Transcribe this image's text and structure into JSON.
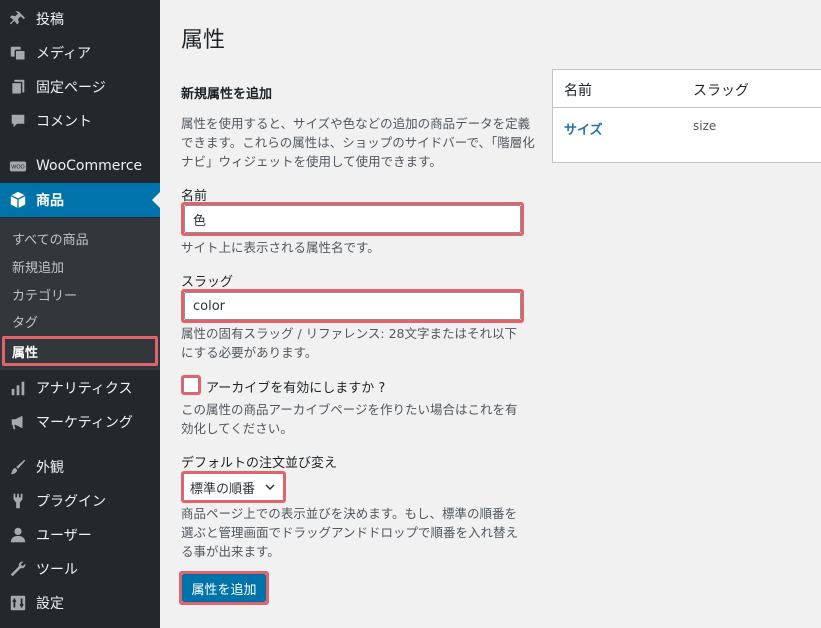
{
  "sidebar": {
    "items": [
      {
        "label": "投稿",
        "icon": "pushpin-icon"
      },
      {
        "label": "メディア",
        "icon": "media-icon"
      },
      {
        "label": "固定ページ",
        "icon": "pages-icon"
      },
      {
        "label": "コメント",
        "icon": "comment-icon"
      },
      {
        "label": "WooCommerce",
        "icon": "woocommerce-icon"
      },
      {
        "label": "商品",
        "icon": "product-box-icon"
      },
      {
        "label": "アナリティクス",
        "icon": "bar-chart-icon"
      },
      {
        "label": "マーケティング",
        "icon": "megaphone-icon"
      },
      {
        "label": "外観",
        "icon": "brush-icon"
      },
      {
        "label": "プラグイン",
        "icon": "plugin-icon"
      },
      {
        "label": "ユーザー",
        "icon": "user-icon"
      },
      {
        "label": "ツール",
        "icon": "wrench-icon"
      },
      {
        "label": "設定",
        "icon": "settings-icon"
      }
    ],
    "submenu": [
      {
        "label": "すべての商品"
      },
      {
        "label": "新規追加"
      },
      {
        "label": "カテゴリー"
      },
      {
        "label": "タグ"
      },
      {
        "label": "属性"
      }
    ]
  },
  "page": {
    "title": "属性",
    "form_title": "新規属性を追加",
    "form_desc": "属性を使用すると、サイズや色などの追加の商品データを定義できます。これらの属性は、ショップのサイドバーで、「階層化ナビ」ウィジェットを使用して使用できます。",
    "name_label": "名前",
    "name_value": "色",
    "name_help": "サイト上に表示される属性名です。",
    "slug_label": "スラッグ",
    "slug_value": "color",
    "slug_help": "属性の固有スラッグ / リファレンス: 28文字またはそれ以下にする必要があります。",
    "archive_label": "アーカイブを有効にしますか ?",
    "archive_checked": false,
    "archive_help": "この属性の商品アーカイブページを作りたい場合はこれを有効化してください。",
    "order_label": "デフォルトの注文並び変え",
    "order_value": "標準の順番",
    "order_help": "商品ページ上での表示並びを決めます。もし、標準の順番を選ぶと管理画面でドラッグアンドドロップで順番を入れ替える事が出来ます。",
    "submit_label": "属性を追加"
  },
  "table": {
    "headers": [
      "名前",
      "スラッグ"
    ],
    "rows": [
      {
        "name": "サイズ",
        "slug": "size"
      }
    ]
  },
  "colors": {
    "sidebar_bg": "#23282d",
    "submenu_bg": "#32373c",
    "accent": "#0073aa",
    "highlight": "#e0646d"
  }
}
